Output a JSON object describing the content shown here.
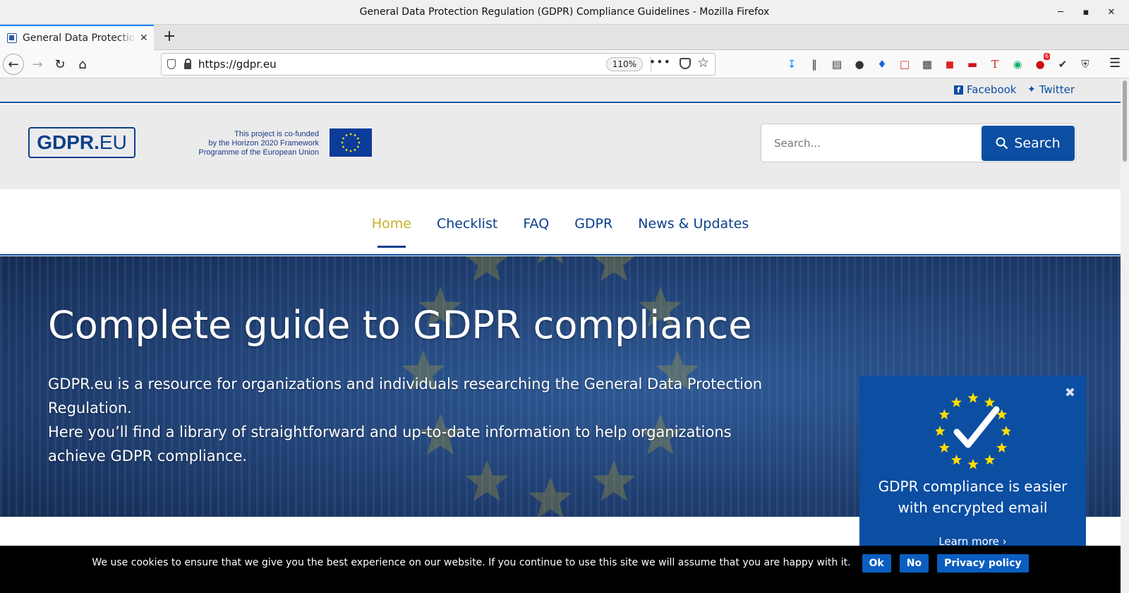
{
  "window": {
    "title": "General Data Protection Regulation (GDPR) Compliance Guidelines - Mozilla Firefox"
  },
  "tab": {
    "title": "General Data Protection Regulation (GDPR) Compliance Guidelines"
  },
  "browser": {
    "url": "https://gdpr.eu",
    "zoom": "110%",
    "badge_count": "6"
  },
  "social": {
    "facebook": "Facebook",
    "twitter": "Twitter"
  },
  "header": {
    "logo_bold": "GDPR.",
    "logo_light": "EU",
    "cofund_line1": "This project is co-funded",
    "cofund_line2": "by the Horizon 2020 Framework",
    "cofund_line3": "Programme of the European Union",
    "search_placeholder": "Search...",
    "search_button": "Search"
  },
  "nav": {
    "items": [
      "Home",
      "Checklist",
      "FAQ",
      "GDPR",
      "News & Updates"
    ],
    "active": "Home"
  },
  "hero": {
    "title": "Complete guide to GDPR compliance",
    "line1": "GDPR.eu is a resource for organizations and individuals researching the General Data Protection Regulation.",
    "line2": "Here you’ll find a library of straightforward and up-to-date information to help organizations",
    "line3": "achieve GDPR compliance."
  },
  "promo": {
    "line1": "GDPR compliance is easier",
    "line2_prefix": "with ",
    "line2_bold": "encrypted email",
    "link": "Learn more"
  },
  "cookie": {
    "text": "We use cookies to ensure that we give you the best experience on our website. If you continue to use this site we will assume that you are happy with it.",
    "ok": "Ok",
    "no": "No",
    "privacy": "Privacy policy"
  },
  "colors": {
    "brand_blue": "#0b4ea2",
    "active_nav": "#c8b028",
    "cookie_bg": "#000000"
  }
}
